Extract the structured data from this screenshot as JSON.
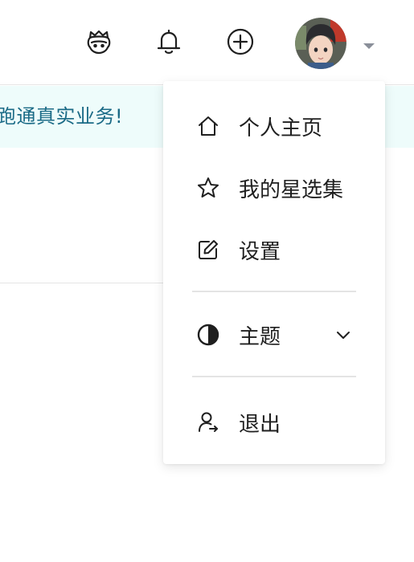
{
  "header": {
    "icons": [
      "mascot-icon",
      "bell-icon",
      "plus-circle-icon"
    ],
    "avatar_icon": "user-avatar",
    "caret_icon": "caret-down-icon"
  },
  "banner": {
    "text": "跑通真实业务!"
  },
  "user_menu": {
    "items": [
      {
        "label": "个人主页",
        "icon": "home-icon"
      },
      {
        "label": "我的星选集",
        "icon": "star-icon"
      },
      {
        "label": "设置",
        "icon": "edit-icon"
      }
    ],
    "theme": {
      "label": "主题",
      "icon": "contrast-icon",
      "chevron": "chevron-down-icon"
    },
    "logout": {
      "label": "退出",
      "icon": "logout-icon"
    }
  },
  "colors": {
    "banner_bg": "#eefcfb",
    "banner_text": "#1a6a86",
    "caret": "#8a8f99"
  }
}
